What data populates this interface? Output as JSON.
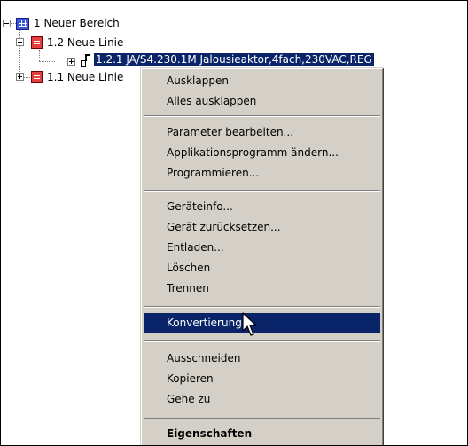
{
  "tree": {
    "nodes": [
      {
        "label": "1 Neuer Bereich",
        "expander": "-"
      },
      {
        "label": "1.2 Neue Linie",
        "expander": "-"
      },
      {
        "label": "1.2.1 JA/S4.230.1M Jalousieaktor,4fach,230VAC,REG",
        "visible_label": "1.2.1 JA/S4.230.1M Jalousieaktor,4fach,230VAC,REG",
        "expander": "+",
        "selected": true
      },
      {
        "label": "1.1 Neue Linie",
        "expander": "+"
      }
    ]
  },
  "context_menu": {
    "items": {
      "ausklappen": "Ausklappen",
      "alles_ausklappen": "Alles ausklappen",
      "parameter": "Parameter bearbeiten...",
      "applikation": "Applikationsprogramm ändern...",
      "programmieren": "Programmieren...",
      "geraeteinfo": "Geräteinfo...",
      "zuruecksetzen": "Gerät zurücksetzen...",
      "entladen": "Entladen...",
      "loeschen": "Löschen",
      "trennen": "Trennen",
      "konvertierung": "Konvertierung",
      "ausschneiden": "Ausschneiden",
      "kopieren": "Kopieren",
      "gehe_zu": "Gehe zu",
      "eigenschaften": "Eigenschaften"
    },
    "highlighted": "Konvertierung"
  },
  "colors": {
    "selection": "#0a246a",
    "menu_background": "#d4d0c8",
    "area_icon": "#3c5ad8",
    "line_icon": "#e04040"
  }
}
